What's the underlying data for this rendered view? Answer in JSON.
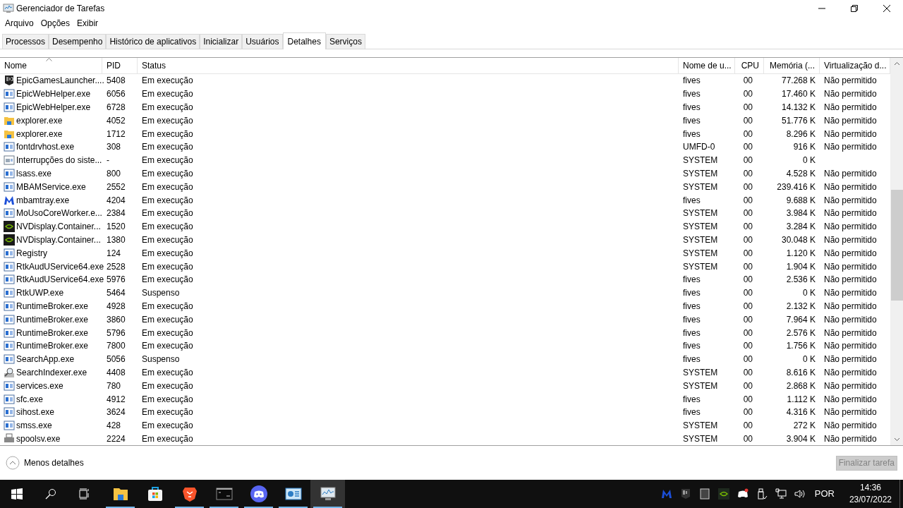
{
  "window": {
    "title": "Gerenciador de Tarefas"
  },
  "menu": [
    "Arquivo",
    "Opções",
    "Exibir"
  ],
  "tabs": [
    {
      "label": "Processos",
      "selected": false
    },
    {
      "label": "Desempenho",
      "selected": false
    },
    {
      "label": "Histórico de aplicativos",
      "selected": false
    },
    {
      "label": "Inicializar",
      "selected": false
    },
    {
      "label": "Usuários",
      "selected": false
    },
    {
      "label": "Detalhes",
      "selected": true
    },
    {
      "label": "Serviços",
      "selected": false
    }
  ],
  "table": {
    "columns": [
      {
        "label": "Nome",
        "sorted": true
      },
      {
        "label": "PID",
        "sorted": false
      },
      {
        "label": "Status",
        "sorted": false
      },
      {
        "label": "Nome de u...",
        "sorted": false
      },
      {
        "label": "CPU",
        "sorted": false
      },
      {
        "label": "Memória (...",
        "sorted": false
      },
      {
        "label": "Virtualização d...",
        "sorted": false
      }
    ],
    "rows": [
      {
        "kind": "epic",
        "name": "EpicGamesLauncher....",
        "pid": "5408",
        "status": "Em execução",
        "user": "fives",
        "cpu": "00",
        "memory": "77.268 K",
        "virtualization": "Não permitido"
      },
      {
        "kind": "app",
        "name": "EpicWebHelper.exe",
        "pid": "6056",
        "status": "Em execução",
        "user": "fives",
        "cpu": "00",
        "memory": "17.460 K",
        "virtualization": "Não permitido"
      },
      {
        "kind": "app",
        "name": "EpicWebHelper.exe",
        "pid": "6728",
        "status": "Em execução",
        "user": "fives",
        "cpu": "00",
        "memory": "14.132 K",
        "virtualization": "Não permitido"
      },
      {
        "kind": "folder",
        "name": "explorer.exe",
        "pid": "4052",
        "status": "Em execução",
        "user": "fives",
        "cpu": "00",
        "memory": "51.776 K",
        "virtualization": "Não permitido"
      },
      {
        "kind": "folder",
        "name": "explorer.exe",
        "pid": "1712",
        "status": "Em execução",
        "user": "fives",
        "cpu": "00",
        "memory": "8.296 K",
        "virtualization": "Não permitido"
      },
      {
        "kind": "app",
        "name": "fontdrvhost.exe",
        "pid": "308",
        "status": "Em execução",
        "user": "UMFD-0",
        "cpu": "00",
        "memory": "916 K",
        "virtualization": "Não permitido"
      },
      {
        "kind": "system",
        "name": "Interrupções do siste...",
        "pid": "-",
        "status": "Em execução",
        "user": "SYSTEM",
        "cpu": "00",
        "memory": "0 K"
      },
      {
        "kind": "app",
        "name": "lsass.exe",
        "pid": "800",
        "status": "Em execução",
        "user": "SYSTEM",
        "cpu": "00",
        "memory": "4.528 K",
        "virtualization": "Não permitido"
      },
      {
        "kind": "app",
        "name": "MBAMService.exe",
        "pid": "2552",
        "status": "Em execução",
        "user": "SYSTEM",
        "cpu": "00",
        "memory": "239.416 K",
        "virtualization": "Não permitido"
      },
      {
        "kind": "malware",
        "name": "mbamtray.exe",
        "pid": "4204",
        "status": "Em execução",
        "user": "fives",
        "cpu": "00",
        "memory": "9.688 K",
        "virtualization": "Não permitido"
      },
      {
        "kind": "app",
        "name": "MoUsoCoreWorker.e...",
        "pid": "2384",
        "status": "Em execução",
        "user": "SYSTEM",
        "cpu": "00",
        "memory": "3.984 K",
        "virtualization": "Não permitido"
      },
      {
        "kind": "nvidia",
        "name": "NVDisplay.Container...",
        "pid": "1520",
        "status": "Em execução",
        "user": "SYSTEM",
        "cpu": "00",
        "memory": "3.284 K",
        "virtualization": "Não permitido"
      },
      {
        "kind": "nvidia",
        "name": "NVDisplay.Container...",
        "pid": "1380",
        "status": "Em execução",
        "user": "SYSTEM",
        "cpu": "00",
        "memory": "30.048 K",
        "virtualization": "Não permitido"
      },
      {
        "kind": "app",
        "name": "Registry",
        "pid": "124",
        "status": "Em execução",
        "user": "SYSTEM",
        "cpu": "00",
        "memory": "1.120 K",
        "virtualization": "Não permitido"
      },
      {
        "kind": "app",
        "name": "RtkAudUService64.exe",
        "pid": "2528",
        "status": "Em execução",
        "user": "SYSTEM",
        "cpu": "00",
        "memory": "1.904 K",
        "virtualization": "Não permitido"
      },
      {
        "kind": "app",
        "name": "RtkAudUService64.exe",
        "pid": "5976",
        "status": "Em execução",
        "user": "fives",
        "cpu": "00",
        "memory": "2.536 K",
        "virtualization": "Não permitido"
      },
      {
        "kind": "app",
        "name": "RtkUWP.exe",
        "pid": "5464",
        "status": "Suspenso",
        "user": "fives",
        "cpu": "00",
        "memory": "0 K",
        "virtualization": "Não permitido"
      },
      {
        "kind": "app",
        "name": "RuntimeBroker.exe",
        "pid": "4928",
        "status": "Em execução",
        "user": "fives",
        "cpu": "00",
        "memory": "2.132 K",
        "virtualization": "Não permitido"
      },
      {
        "kind": "app",
        "name": "RuntimeBroker.exe",
        "pid": "3860",
        "status": "Em execução",
        "user": "fives",
        "cpu": "00",
        "memory": "7.964 K",
        "virtualization": "Não permitido"
      },
      {
        "kind": "app",
        "name": "RuntimeBroker.exe",
        "pid": "5796",
        "status": "Em execução",
        "user": "fives",
        "cpu": "00",
        "memory": "2.576 K",
        "virtualization": "Não permitido"
      },
      {
        "kind": "app",
        "name": "RuntimeBroker.exe",
        "pid": "7800",
        "status": "Em execução",
        "user": "fives",
        "cpu": "00",
        "memory": "1.756 K",
        "virtualization": "Não permitido"
      },
      {
        "kind": "app",
        "name": "SearchApp.exe",
        "pid": "5056",
        "status": "Suspenso",
        "user": "fives",
        "cpu": "00",
        "memory": "0 K",
        "virtualization": "Não permitido"
      },
      {
        "kind": "search",
        "name": "SearchIndexer.exe",
        "pid": "4408",
        "status": "Em execução",
        "user": "SYSTEM",
        "cpu": "00",
        "memory": "8.616 K",
        "virtualization": "Não permitido"
      },
      {
        "kind": "app",
        "name": "services.exe",
        "pid": "780",
        "status": "Em execução",
        "user": "SYSTEM",
        "cpu": "00",
        "memory": "2.868 K",
        "virtualization": "Não permitido"
      },
      {
        "kind": "app",
        "name": "sfc.exe",
        "pid": "4912",
        "status": "Em execução",
        "user": "fives",
        "cpu": "00",
        "memory": "1.112 K",
        "virtualization": "Não permitido"
      },
      {
        "kind": "app",
        "name": "sihost.exe",
        "pid": "3624",
        "status": "Em execução",
        "user": "fives",
        "cpu": "00",
        "memory": "4.316 K",
        "virtualization": "Não permitido"
      },
      {
        "kind": "app",
        "name": "smss.exe",
        "pid": "428",
        "status": "Em execução",
        "user": "SYSTEM",
        "cpu": "00",
        "memory": "272 K",
        "virtualization": "Não permitido"
      },
      {
        "kind": "printer",
        "name": "spoolsv.exe",
        "pid": "2224",
        "status": "Em execução",
        "user": "SYSTEM",
        "cpu": "00",
        "memory": "3.904 K",
        "virtualization": "Não permitido"
      }
    ]
  },
  "footer": {
    "less_details": "Menos detalhes",
    "end_task": {
      "label": "Finalizar tarefa",
      "disabled": true
    }
  },
  "taskbar": {
    "apps": [
      {
        "kind": "folder",
        "running": true,
        "selected": false
      },
      {
        "kind": "store",
        "running": false,
        "selected": false
      },
      {
        "kind": "lion",
        "running": true,
        "selected": false
      },
      {
        "kind": "terminal",
        "running": true,
        "selected": false
      },
      {
        "kind": "chat",
        "running": true,
        "selected": false
      },
      {
        "kind": "panel",
        "running": true,
        "selected": false
      },
      {
        "kind": "monitor",
        "running": true,
        "selected": true
      }
    ],
    "language": "POR",
    "time": "14:36",
    "date": "23/07/2022"
  }
}
